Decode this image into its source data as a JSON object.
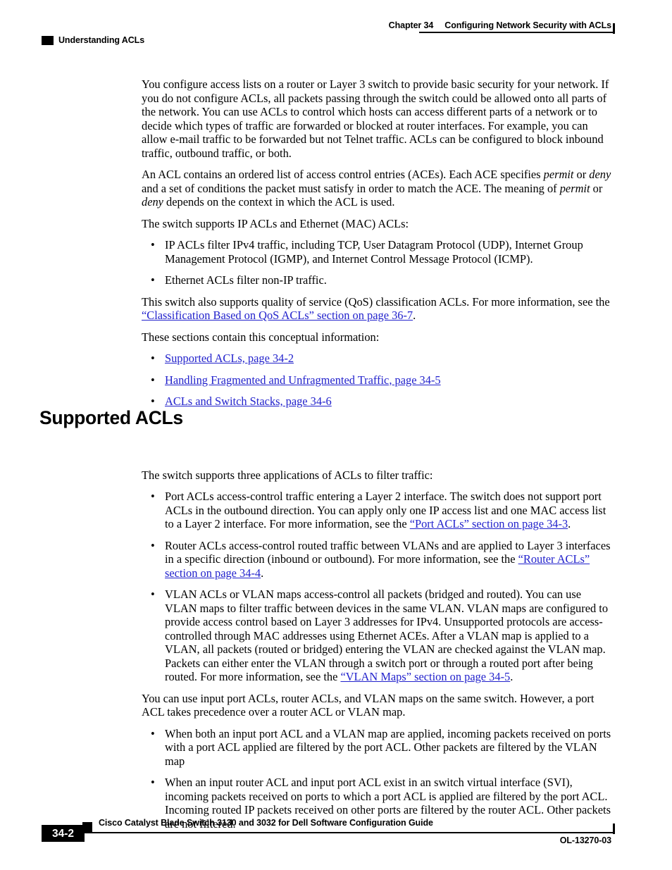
{
  "header": {
    "chapter_number": "Chapter 34",
    "chapter_title": "Configuring Network Security with ACLs",
    "section_title": "Understanding ACLs"
  },
  "colors": {
    "link": "#2222CC",
    "text": "#000000",
    "background": "#FFFFFF"
  },
  "intro": {
    "para1": "You configure access lists on a router or Layer 3 switch to provide basic security for your network. If you do not configure ACLs, all packets passing through the switch could be allowed onto all parts of the network. You can use ACLs to control which hosts can access different parts of a network or to decide which types of traffic are forwarded or blocked at router interfaces. For example, you can allow e-mail traffic to be forwarded but not Telnet traffic. ACLs can be configured to block inbound traffic, outbound traffic, or both.",
    "para2_a": "An ACL contains an ordered list of access control entries (ACEs). Each ACE specifies ",
    "para2_em1": "permit",
    "para2_b": " or ",
    "para2_em2": "deny",
    "para2_c": " and a set of conditions the packet must satisfy in order to match the ACE. The meaning of ",
    "para2_em3": "permit",
    "para2_d": " or ",
    "para2_em4": "deny",
    "para2_e": " depends on the context in which the ACL is used.",
    "para3": "The switch supports IP ACLs and Ethernet (MAC) ACLs:",
    "bullets": [
      "IP ACLs filter IPv4 traffic, including TCP, User Datagram Protocol (UDP), Internet Group Management Protocol (IGMP), and Internet Control Message Protocol (ICMP).",
      "Ethernet ACLs filter non-IP traffic."
    ],
    "para4_a": "This switch also supports quality of service (QoS) classification ACLs. For more information, see the ",
    "para4_link": "“Classification Based on QoS ACLs” section on page 36-7",
    "para4_b": ".",
    "para5": "These sections contain this conceptual information:",
    "toc_links": [
      "Supported ACLs, page 34-2",
      "Handling Fragmented and Unfragmented Traffic, page 34-5",
      "ACLs and Switch Stacks, page 34-6"
    ]
  },
  "supported_acls": {
    "heading": "Supported ACLs",
    "intro": "The switch supports three applications of ACLs to filter traffic:",
    "bullet1_a": "Port ACLs access-control traffic entering a Layer 2 interface. The switch does not support port ACLs in the outbound direction. You can apply only one IP access list and one MAC access list to a Layer 2 interface. For more information, see the ",
    "bullet1_link": "“Port ACLs” section on page 34-3",
    "bullet1_b": ".",
    "bullet2_a": "Router ACLs access-control routed traffic between VLANs and are applied to Layer 3 interfaces in a specific direction (inbound or outbound). For more information, see the ",
    "bullet2_link": "“Router ACLs” section on page 34-4",
    "bullet2_b": ".",
    "bullet3_a": "VLAN ACLs or VLAN maps access-control all packets (bridged and routed). You can use VLAN maps to filter traffic between devices in the same VLAN. VLAN maps are configured to provide access control based on Layer 3 addresses for IPv4. Unsupported protocols are access-controlled through MAC addresses using Ethernet ACEs. After a VLAN map is applied to a VLAN, all packets (routed or bridged) entering the VLAN are checked against the VLAN map. Packets can either enter the VLAN through a switch port or through a routed port after being routed. For more information, see the ",
    "bullet3_link": "“VLAN Maps” section on page 34-5",
    "bullet3_b": ".",
    "closing_para": "You can use input port ACLs, router ACLs, and VLAN maps on the same switch. However, a port ACL takes precedence over a router ACL or VLAN map.",
    "closing_bullets": [
      "When both an input port ACL and a VLAN map are applied, incoming packets received on ports with a port ACL applied are filtered by the port ACL. Other packets are filtered by the VLAN map",
      "When an input router ACL and input port ACL exist in an switch virtual interface (SVI), incoming packets received on ports to which a port ACL is applied are filtered by the port ACL. Incoming routed IP packets received on other ports are filtered by the router ACL. Other packets are not filtered."
    ]
  },
  "bullet_glyph": "•",
  "footer": {
    "page_number": "34-2",
    "document_title": "Cisco Catalyst Blade Switch 3130 and 3032 for Dell Software Configuration Guide",
    "document_id": "OL-13270-03"
  }
}
